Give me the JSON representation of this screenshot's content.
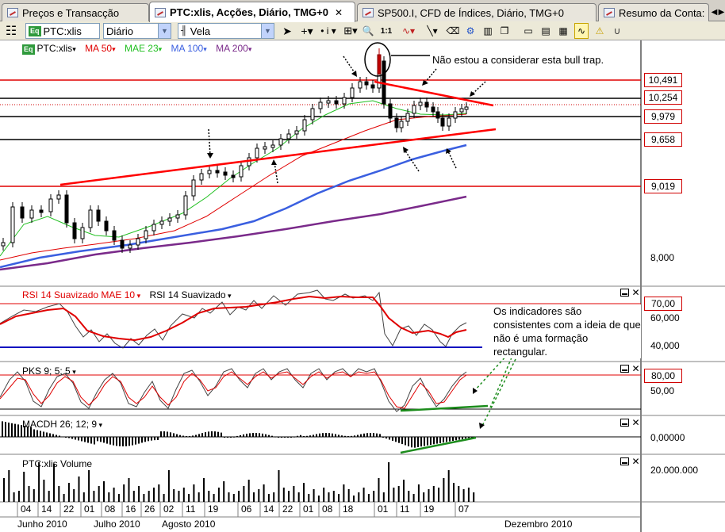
{
  "tabs": [
    {
      "label": "Preços e Transacção",
      "active": false,
      "closable": false
    },
    {
      "label": "PTC:xlis, Acções, Diário, TMG+0",
      "active": true,
      "closable": true
    },
    {
      "label": "SP500.I, CFD de Índices, Diário, TMG+0",
      "active": false,
      "closable": false
    },
    {
      "label": "Resumo da Conta:",
      "active": false,
      "closable": false
    }
  ],
  "toolbar": {
    "symbol": "PTC:xlis",
    "symbol_badge": "Eq",
    "interval": "Diário",
    "chart_type": "Vela",
    "zoom_ratio": "1:1"
  },
  "main_panel": {
    "legend_symbol": "PTC:xlis",
    "legend_badge": "Eq",
    "indicators": [
      {
        "label": "MA 50",
        "color": "#e00000"
      },
      {
        "label": "MAE 23",
        "color": "#22c022"
      },
      {
        "label": "MA 100",
        "color": "#3a5fe0"
      },
      {
        "label": "MA 200",
        "color": "#7a2a8a"
      }
    ],
    "price_levels": [
      "10,491",
      "10,254",
      "9,979",
      "9,658",
      "9,019"
    ],
    "axis_label": "8,000",
    "annotation": "Não estou a considerar esta bull trap."
  },
  "rsi_panel": {
    "legend_mae": "RSI 14 Suavizado MAE 10",
    "legend_rsi": "RSI 14 Suavizado",
    "level_box": "70,00",
    "axis_labels": [
      "60,000",
      "40,000"
    ],
    "annotation": "Os indicadores são consistentes com a ideia de que não é uma formação rectangular."
  },
  "pks_panel": {
    "legend": "PKS 9; 5; 5",
    "level_box": "80,00",
    "axis_label": "50,00"
  },
  "macd_panel": {
    "legend": "MACDH 26; 12; 9",
    "axis_label": "0,00000"
  },
  "volume_panel": {
    "legend": "PTC:xlis Volume",
    "axis_label": "20.000.000"
  },
  "date_axis": {
    "days": [
      "04",
      "14",
      "22",
      "01",
      "08",
      "16",
      "26",
      "02",
      "11",
      "19",
      "06",
      "14",
      "22",
      "01",
      "08",
      "18",
      "01",
      "11",
      "19",
      "07"
    ],
    "months": [
      "Junho 2010",
      "Julho 2010",
      "Agosto 2010",
      "Dezembro 2010"
    ]
  },
  "colors": {
    "red_level": "#e00000",
    "trend_red": "#ff0000",
    "green_trend": "#1c8c1c",
    "rsi_base": "#1010c0"
  }
}
